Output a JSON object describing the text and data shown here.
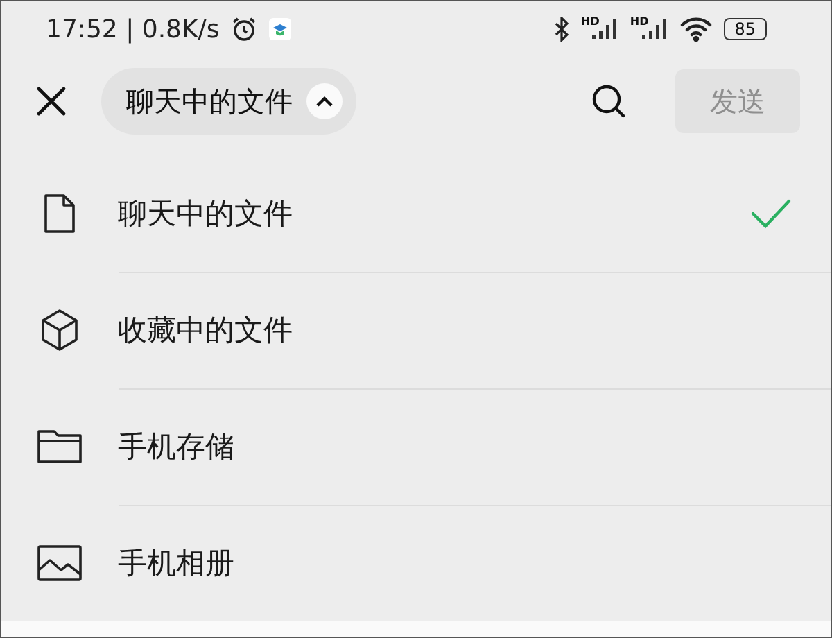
{
  "status_bar": {
    "clock_speed": "17:52 | 0.8K/s",
    "signal_labels": [
      "HD",
      "HD"
    ],
    "battery": "85"
  },
  "top_bar": {
    "source_selector": {
      "label": "聊天中的文件",
      "expanded": true
    },
    "send_button": {
      "label": "发送",
      "disabled": true
    }
  },
  "items": [
    {
      "kind": "file",
      "label": "聊天中的文件",
      "selected": true
    },
    {
      "kind": "cube",
      "label": "收藏中的文件",
      "selected": false
    },
    {
      "kind": "folder",
      "label": "手机存储",
      "selected": false
    },
    {
      "kind": "image",
      "label": "手机相册",
      "selected": false
    }
  ]
}
